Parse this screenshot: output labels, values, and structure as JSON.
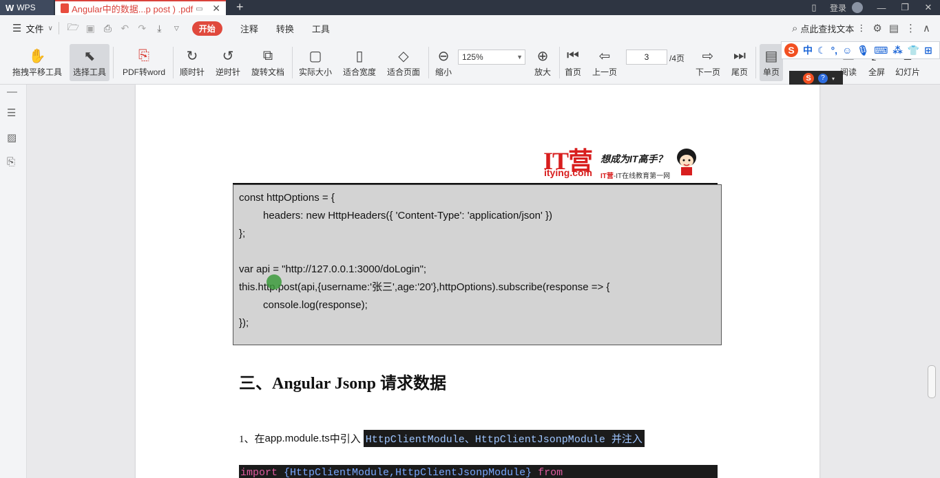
{
  "titlebar": {
    "app_tab": "WPS",
    "doc_tab": "Angular中的数据...p post ) .pdf",
    "new_tab": "+",
    "login": "登录"
  },
  "menubar": {
    "file": "文件",
    "start": "开始",
    "items": [
      "注释",
      "转换",
      "工具"
    ],
    "find_text": "点此查找文本"
  },
  "toolbar": {
    "tools": [
      {
        "label": "拖拽平移工具",
        "icon": "hand-icon"
      },
      {
        "label": "选择工具",
        "icon": "cursor-icon"
      },
      {
        "label": "PDF转word",
        "icon": "pdf-to-word-icon"
      },
      {
        "label": "顺时针",
        "icon": "rotate-cw-icon"
      },
      {
        "label": "逆时针",
        "icon": "rotate-ccw-icon"
      },
      {
        "label": "旋转文档",
        "icon": "rotate-doc-icon"
      },
      {
        "label": "实际大小",
        "icon": "actual-size-icon"
      },
      {
        "label": "适合宽度",
        "icon": "fit-width-icon"
      },
      {
        "label": "适合页面",
        "icon": "fit-page-icon"
      },
      {
        "label": "缩小",
        "icon": "zoom-out-icon"
      },
      {
        "label": "放大",
        "icon": "zoom-in-icon"
      },
      {
        "label": "首页",
        "icon": "first-page-icon"
      },
      {
        "label": "上一页",
        "icon": "prev-page-icon"
      },
      {
        "label": "下一页",
        "icon": "next-page-icon"
      },
      {
        "label": "尾页",
        "icon": "last-page-icon"
      },
      {
        "label": "单页",
        "icon": "single-page-icon"
      },
      {
        "label": "阅读",
        "icon": "read-icon"
      },
      {
        "label": "全屏",
        "icon": "fullscreen-icon"
      },
      {
        "label": "幻灯片",
        "icon": "slideshow-icon"
      }
    ],
    "zoom": "125%",
    "page_current": "3",
    "page_total": "/4页"
  },
  "ime": {
    "lang": "中"
  },
  "document": {
    "logo": {
      "it": "IT营",
      "site": "itying.com",
      "slogan": "想成为IT高手？",
      "sub_brand": "IT营",
      "sub_rest": "-IT在线教育第一网"
    },
    "code_lines": [
      "const httpOptions = {",
      "headers: new HttpHeaders({ 'Content-Type': 'application/json' })",
      "};",
      "",
      "var api = \"http://127.0.0.1:3000/doLogin\";",
      "this.http.post(api,{username:'张三',age:'20'},httpOptions).subscribe(response => {",
      "console.log(response);",
      "});"
    ],
    "heading": "三、Angular Jsonp 请求数据",
    "para_prefix_num": "1、在 ",
    "para_file": "app.module.ts",
    "para_mid": " 中引入 ",
    "para_highlight": "HttpClientModule、HttpClientJsonpModule 并注入",
    "code_bottom": {
      "kw1": "import",
      "ids": " {HttpClientModule,HttpClientJsonpModule} ",
      "kw2": "from"
    }
  }
}
